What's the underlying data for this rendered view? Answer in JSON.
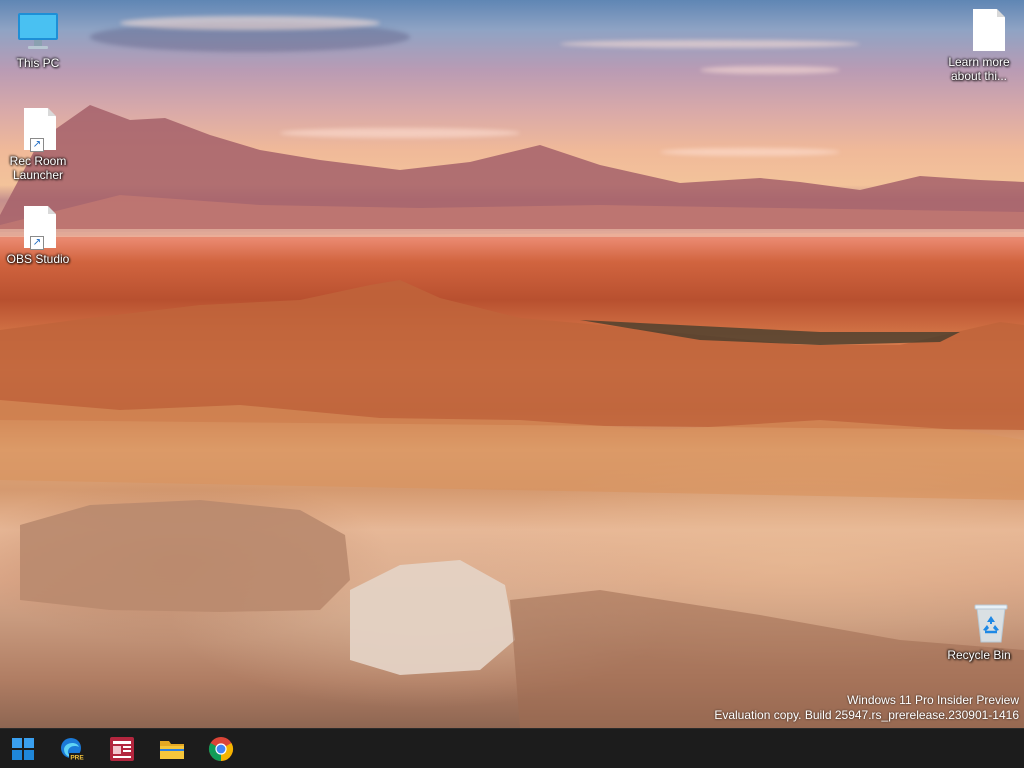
{
  "desktop": {
    "icons": [
      {
        "label": "This PC",
        "icon": "monitor-icon"
      },
      {
        "label": "Rec Room Launcher",
        "icon": "document-icon",
        "shortcut": true
      },
      {
        "label": "OBS Studio",
        "icon": "document-icon",
        "shortcut": true
      },
      {
        "label": "Learn more about thi...",
        "icon": "document-icon"
      },
      {
        "label": "Recycle Bin",
        "icon": "recycle-bin-icon"
      }
    ]
  },
  "watermark": {
    "line1": "Windows 11 Pro Insider Preview",
    "line2": "Evaluation copy. Build 25947.rs_prerelease.230901-1416"
  },
  "taskbar": {
    "items": [
      {
        "name": "windows-start-icon"
      },
      {
        "name": "edge-beta-icon",
        "badge": "PRE"
      },
      {
        "name": "news-app-icon"
      },
      {
        "name": "file-explorer-icon"
      },
      {
        "name": "chrome-icon"
      }
    ]
  },
  "colors": {
    "taskbar_bg": "#1c1c1c",
    "windows_blue": "#0078d4",
    "monitor_blue": "#2aa7e8",
    "news_red": "#b3263e",
    "folder_yellow": "#f6c63b"
  }
}
